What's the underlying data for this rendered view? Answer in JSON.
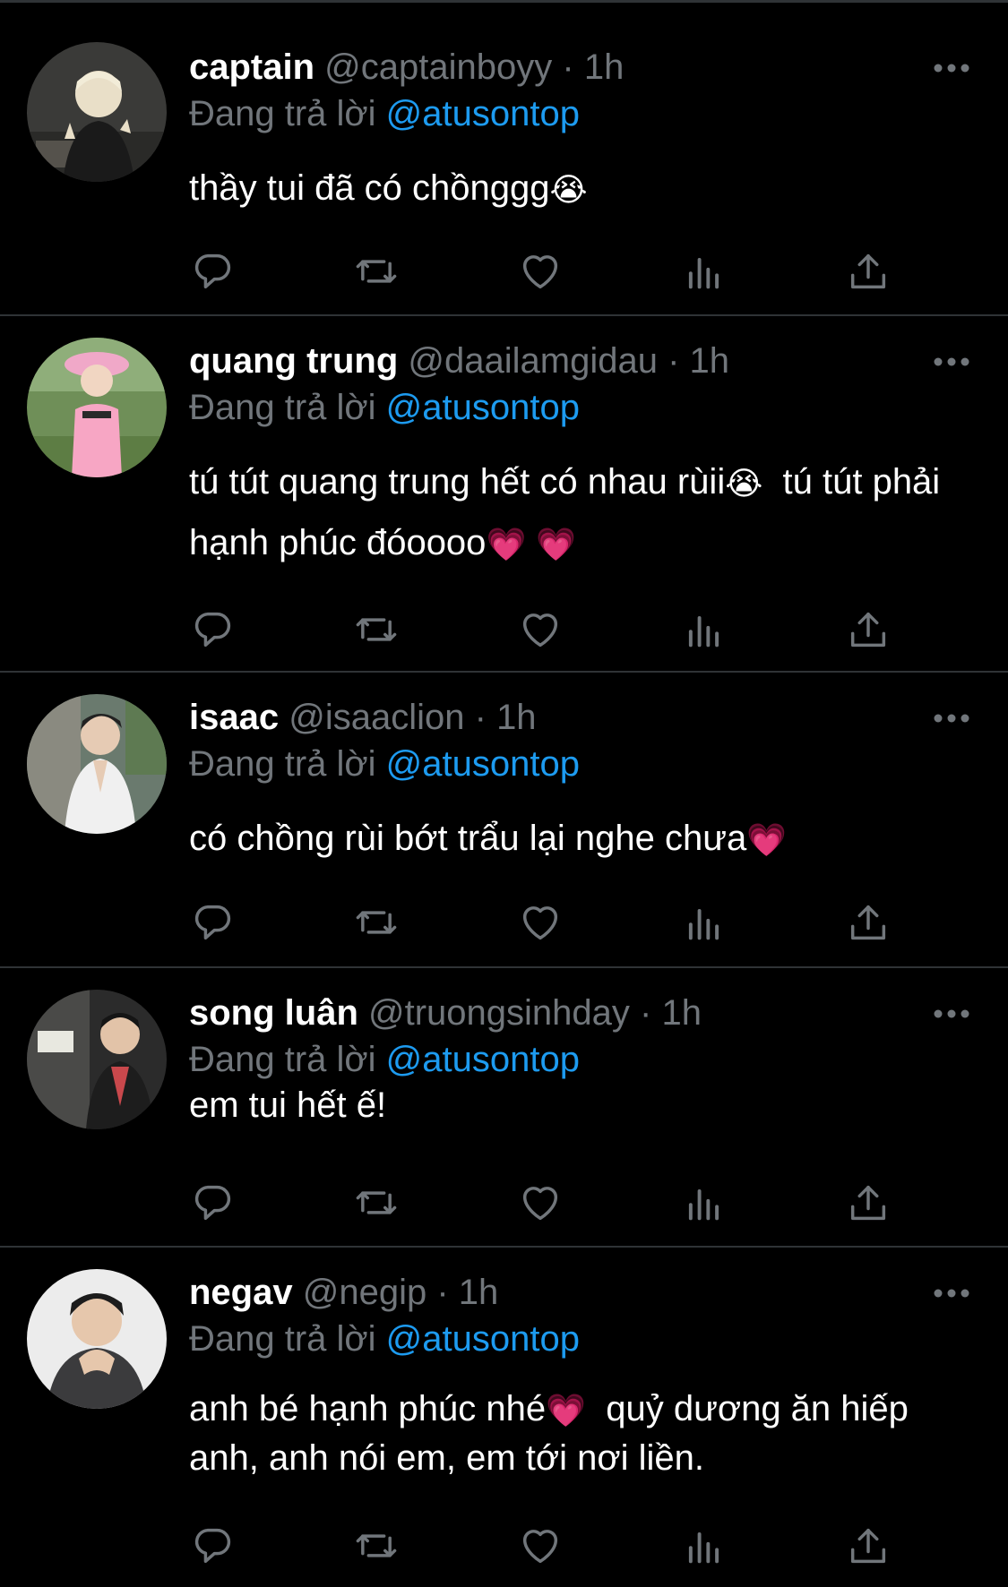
{
  "reply_prefix": "Đang trả lời",
  "reply_handle": "@atusontop",
  "tweets": [
    {
      "name": "captain",
      "handle": "@captainboyy",
      "separator": "·",
      "time": "1h",
      "text_parts": [
        "thầy tui đã có chồnggg",
        "😭"
      ]
    },
    {
      "name": "quang trung",
      "handle": "@daailamgidau",
      "separator": "·",
      "time": "1h",
      "text_parts": [
        "tú tút quang trung hết có nhau rùii",
        "😭",
        "  tú tút phải hạnh phúc đóoooo",
        "💗",
        " ",
        "💗"
      ]
    },
    {
      "name": "isaac",
      "handle": "@isaaclion",
      "separator": "·",
      "time": "1h",
      "text_parts": [
        "có chồng rùi bớt trẩu lại nghe chưa",
        "💗"
      ]
    },
    {
      "name": "song luân",
      "handle": "@truongsinhday",
      "separator": "·",
      "time": "1h",
      "text_parts": [
        "em tui hết ế!"
      ]
    },
    {
      "name": "negav",
      "handle": "@negip",
      "separator": "·",
      "time": "1h",
      "text_parts": [
        "anh bé hạnh phúc nhé",
        "💗",
        "  quỷ dương ăn hiếp anh, anh nói em, em tới nơi liền."
      ]
    }
  ],
  "icons": {
    "reply": "reply-icon",
    "retweet": "retweet-icon",
    "like": "heart-icon",
    "views": "views-icon",
    "share": "share-icon",
    "more": "more-icon"
  },
  "colors": {
    "background": "#000000",
    "name": "#ffffff",
    "muted": "#71767b",
    "link": "#1d9bf0",
    "divider": "#2f3336"
  }
}
